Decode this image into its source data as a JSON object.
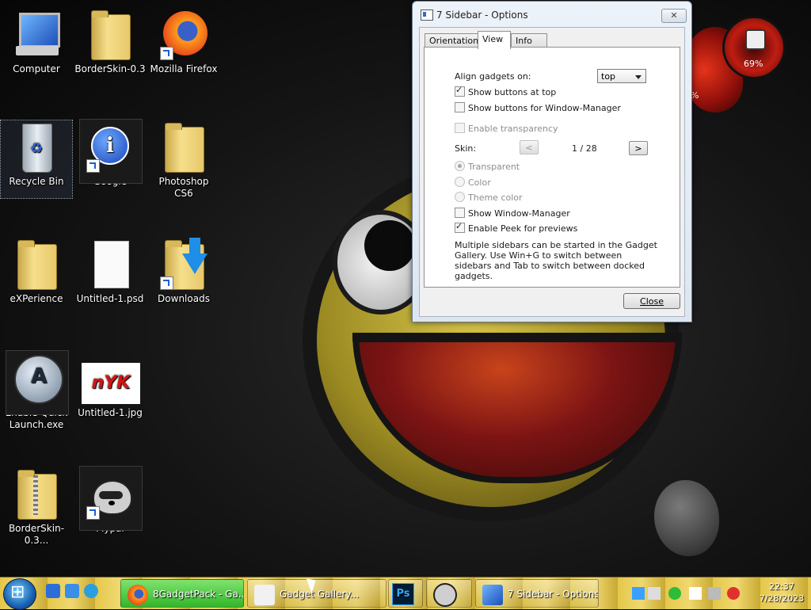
{
  "desktop": {
    "icons": [
      {
        "label": "Computer"
      },
      {
        "label": "BorderSkin-0.3"
      },
      {
        "label": "Mozilla Firefox"
      },
      {
        "label": "Recycle Bin"
      },
      {
        "label": "Google"
      },
      {
        "label": "Photoshop CS6"
      },
      {
        "label": "eXPerience"
      },
      {
        "label": "Untitled-1.psd"
      },
      {
        "label": "Downloads"
      },
      {
        "label": "Enable Quick Launch.exe"
      },
      {
        "label": "Untitled-1.jpg"
      },
      {
        "label": "BorderSkin-0.3..."
      },
      {
        "label": "Mypal"
      }
    ],
    "nyk_text": "nYK"
  },
  "gadgets": {
    "ram_percent": "69%",
    "cpu_percent": "%"
  },
  "dialog": {
    "title": "7 Sidebar - Options",
    "close_glyph": "✕",
    "tabs": [
      {
        "label": "Orientation"
      },
      {
        "label": "View"
      },
      {
        "label": "Info"
      }
    ],
    "active_tab": "View",
    "align_label": "Align gadgets on:",
    "align_value": "top",
    "show_buttons_top": "Show buttons at top",
    "show_buttons_wm": "Show buttons for Window-Manager",
    "enable_transparency": "Enable transparency",
    "skin_label": "Skin:",
    "skin_prev": "<",
    "skin_next": ">",
    "skin_count": "1 / 28",
    "radio_transparent": "Transparent",
    "radio_color": "Color",
    "radio_theme": "Theme color",
    "show_wm": "Show Window-Manager",
    "enable_peek": "Enable Peek for previews",
    "help_text": "Multiple sidebars can be started in the Gadget Gallery. Use Win+G to switch between sidebars and Tab to switch between docked gadgets.",
    "close_label": "Close"
  },
  "taskbar": {
    "tasks": [
      {
        "label": "8GadgetPack - Ga..."
      },
      {
        "label": "Gadget Gallery..."
      },
      {
        "label": ""
      },
      {
        "label": "7 Sidebar - Options"
      }
    ],
    "clock_time": "22:37",
    "clock_date": "7/28/2023"
  },
  "colors": {
    "active_task": "#33b62a",
    "accent_blue": "#1f5fd0"
  }
}
